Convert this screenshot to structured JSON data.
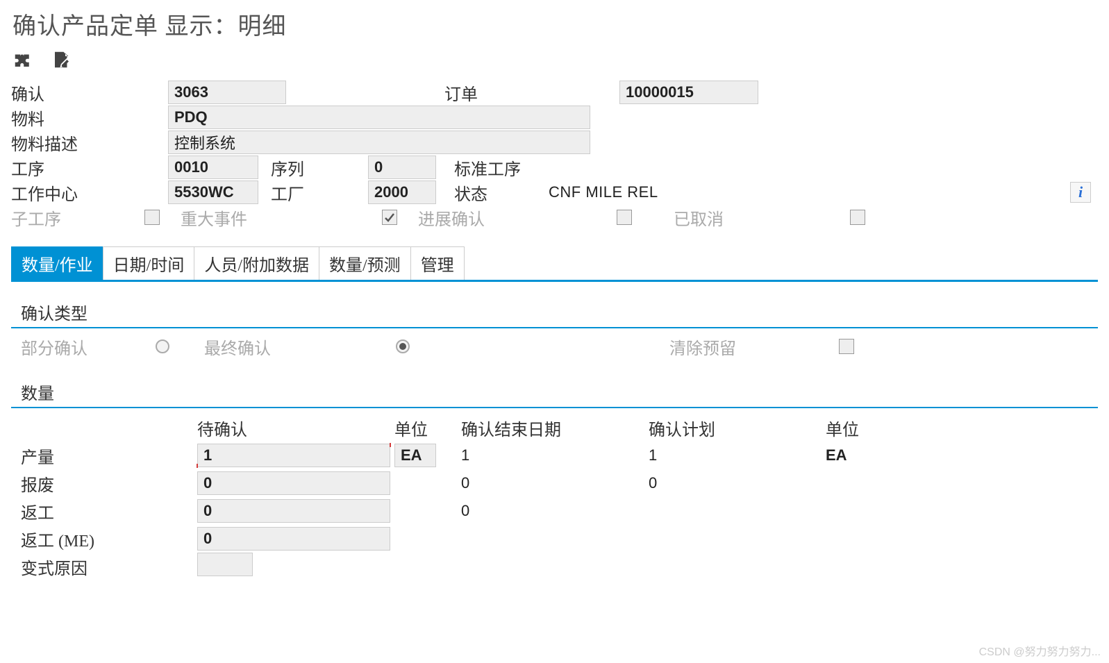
{
  "title": "确认产品定单 显示：明细",
  "header": {
    "confirm_lbl": "确认",
    "confirm_val": "3063",
    "order_lbl": "订单",
    "order_val": "10000015",
    "material_lbl": "物料",
    "material_val": "PDQ",
    "matdesc_lbl": "物料描述",
    "matdesc_val": "控制系统",
    "oper_lbl": "工序",
    "oper_val": "0010",
    "seq_lbl": "序列",
    "seq_val": "0",
    "stdoper_lbl": "标准工序",
    "wc_lbl": "工作中心",
    "wc_val": "5530WC",
    "plant_lbl": "工厂",
    "plant_val": "2000",
    "status_lbl": "状态",
    "status_val": "CNF  MILE REL",
    "subop_lbl": "子工序",
    "milestone_lbl": "重大事件",
    "progress_lbl": "进展确认",
    "cancelled_lbl": "已取消"
  },
  "tabs": {
    "t0": "数量/作业",
    "t1": "日期/时间",
    "t2": "人员/附加数据",
    "t3": "数量/预测",
    "t4": "管理"
  },
  "confirm_type": {
    "group_title": "确认类型",
    "partial_lbl": "部分确认",
    "final_lbl": "最终确认",
    "clear_lbl": "清除预留"
  },
  "qty": {
    "group_title": "数量",
    "col_pending": "待确认",
    "col_unit": "单位",
    "col_enddate": "确认结束日期",
    "col_plan": "确认计划",
    "col_unit2": "单位",
    "rows": {
      "yield_lbl": "产量",
      "yield_pending": "1",
      "yield_unit": "EA",
      "yield_end": "1",
      "yield_plan": "1",
      "yield_unit2": "EA",
      "scrap_lbl": "报废",
      "scrap_pending": "0",
      "scrap_end": "0",
      "scrap_plan": "0",
      "rework_lbl": "返工",
      "rework_pending": "0",
      "rework_end": "0",
      "reworkme_lbl": "返工 (ME)",
      "reworkme_pending": "0",
      "variance_lbl": "变式原因"
    }
  },
  "watermark": "CSDN @努力努力努力..."
}
